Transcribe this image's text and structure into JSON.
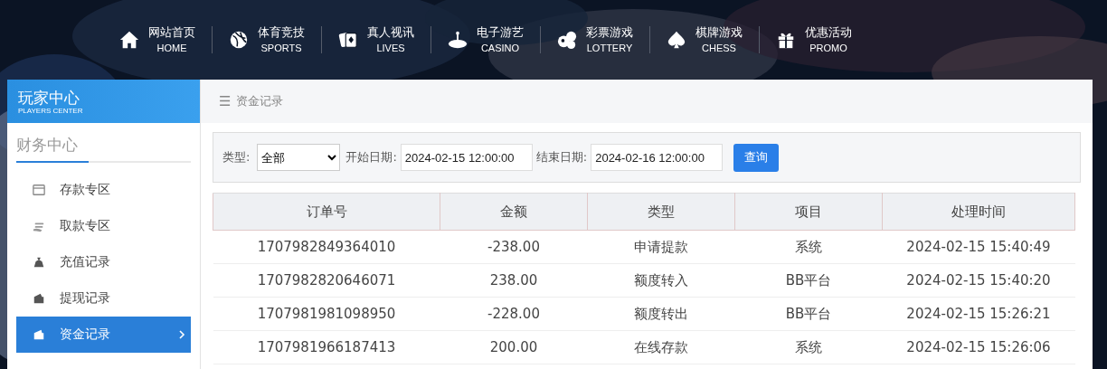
{
  "nav": [
    {
      "label": "网站首页",
      "sub": "HOME"
    },
    {
      "label": "体育竞技",
      "sub": "SPORTS"
    },
    {
      "label": "真人视讯",
      "sub": "LIVES"
    },
    {
      "label": "电子游艺",
      "sub": "CASINO"
    },
    {
      "label": "彩票游戏",
      "sub": "LOTTERY"
    },
    {
      "label": "棋牌游戏",
      "sub": "CHESS"
    },
    {
      "label": "优惠活动",
      "sub": "PROMO"
    }
  ],
  "sidebar": {
    "title": "玩家中心",
    "subtitle": "PLAYERS CENTER",
    "section": "财务中心",
    "items": [
      {
        "label": "存款专区",
        "selected": false
      },
      {
        "label": "取款专区",
        "selected": false
      },
      {
        "label": "充值记录",
        "selected": false
      },
      {
        "label": "提现记录",
        "selected": false
      },
      {
        "label": "资金记录",
        "selected": true
      }
    ]
  },
  "breadcrumb": {
    "icon": "☰",
    "label": "资金记录"
  },
  "filter": {
    "type_label": "类型:",
    "type_value": "全部",
    "start_label": "开始日期:",
    "start_value": "2024-02-15 12:00:00",
    "end_label": "结束日期:",
    "end_value": "2024-02-16 12:00:00",
    "button": "查询"
  },
  "table": {
    "columns": [
      "订单号",
      "金额",
      "类型",
      "项目",
      "处理时间"
    ],
    "rows": [
      [
        "1707982849364010",
        "-238.00",
        "申请提款",
        "系统",
        "2024-02-15 15:40:49"
      ],
      [
        "1707982820646071",
        "238.00",
        "额度转入",
        "BB平台",
        "2024-02-15 15:40:20"
      ],
      [
        "1707981981098950",
        "-228.00",
        "额度转出",
        "BB平台",
        "2024-02-15 15:26:21"
      ],
      [
        "1707981966187413",
        "200.00",
        "在线存款",
        "系统",
        "2024-02-15 15:26:06"
      ]
    ]
  }
}
